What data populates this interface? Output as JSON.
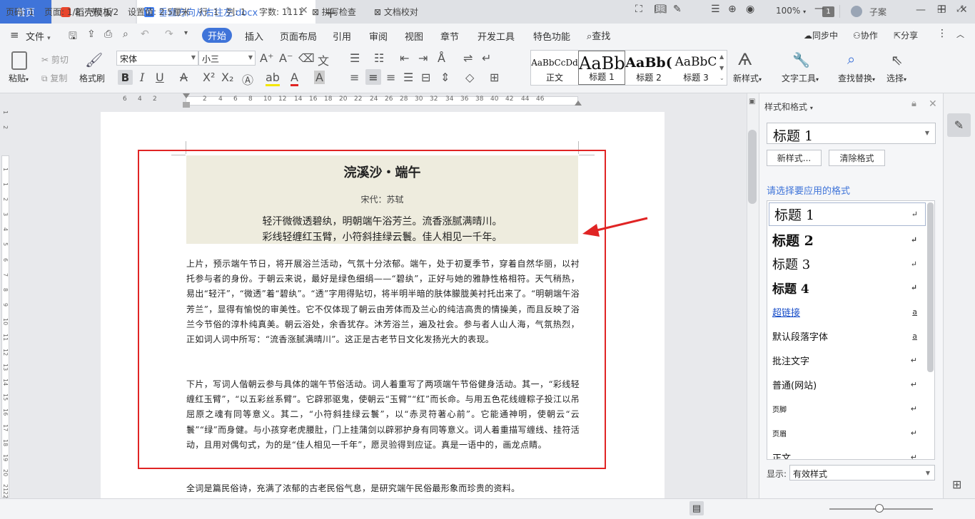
{
  "tabs": {
    "home": "首页",
    "templates": "稻壳模板",
    "document": "垂直方向从右往左.docx",
    "badge": "1",
    "user": "子案"
  },
  "menu": {
    "file": "文件",
    "items": [
      "开始",
      "插入",
      "页面布局",
      "引用",
      "审阅",
      "视图",
      "章节",
      "开发工具",
      "特色功能"
    ],
    "search": "查找",
    "sync": "同步中",
    "collab": "协作",
    "share": "分享"
  },
  "ribbon": {
    "paste": "粘贴",
    "cut": "剪切",
    "copy": "复制",
    "format_painter": "格式刷",
    "font_name": "宋体",
    "font_size": "小三",
    "styles": [
      {
        "preview": "AaBbCcDd",
        "name": "正文"
      },
      {
        "preview": "AaBb",
        "name": "标题 1"
      },
      {
        "preview": "AaBb(",
        "name": "标题 2"
      },
      {
        "preview": "AaBbC",
        "name": "标题 3"
      }
    ],
    "new_style": "新样式",
    "text_tools": "文字工具",
    "find_replace": "查找替换",
    "select": "选择"
  },
  "ruler": {
    "h_ticks": [
      "6",
      "4",
      "2",
      "2",
      "4",
      "6",
      "8",
      "10",
      "12",
      "14",
      "16",
      "18",
      "20",
      "22",
      "24",
      "26",
      "28",
      "30",
      "32",
      "34",
      "36",
      "38",
      "40",
      "42",
      "44",
      "46"
    ],
    "v_ticks": [
      "1",
      "2",
      "1",
      "1",
      "2",
      "3",
      "4",
      "5",
      "6",
      "7",
      "8",
      "9",
      "10",
      "11",
      "12",
      "13",
      "14",
      "15",
      "16",
      "17",
      "18",
      "19",
      "20",
      "21",
      "22",
      "23"
    ]
  },
  "document": {
    "title": "浣溪沙・端午",
    "author": "宋代：苏轼",
    "line1": "轻汗微微透碧纨，明朝端午浴芳兰。流香涨腻满晴川。",
    "line2": "彩线轻缠红玉臂，小符斜挂绿云鬟。佳人相见一千年。",
    "para1": "上片，预示端午节日，将开展浴兰活动，气氛十分浓郁。端午，处于初夏季节，穿着自然华丽，以衬托参与者的身份。于朝云来说，最好是绿色细绢——“碧纨”，正好与她的雅静性格相符。天气稍热，易出“轻汗”，“微透”着“碧纨”。“透”字用得贴切，将半明半暗的肤体朦胧美衬托出来了。“明朝端午浴芳兰”，显得有愉悦的审美性。它不仅体现了朝云由芳体而及兰心的纯洁高贵的情操美，而且反映了浴兰今节俗的淳朴纯真美。朝云浴处，余香犹存。沐芳浴兰，遍及社会。参与者人山人海，气氛热烈，正如词人词中所写：“流香涨腻满晴川”。这正是古老节日文化发扬光大的表现。",
    "para2": "下片，写词人偕朝云参与具体的端午节俗活动。词人着重写了两项端午节俗健身活动。其一，“彩线轻缠红玉臂”，“以五彩丝系臂”。它辟邪驱鬼，使朝云“玉臂”“红”而长命。与用五色花线缠粽子投江以吊屈原之魂有同等意义。其二，“小符斜挂绿云鬟”，以“赤灵符著心前”。它能通神明，使朝云“云鬟”“绿”而身健。与小孩穿老虎腰肚，门上挂蒲剑以辟邪护身有同等意义。词人着重描写缠线、挂符活动，且用对偶句式，为的是“佳人相见一千年”，愿灵验得到应证。真是一语中的，画龙点睛。",
    "para3": "全词是篇民俗诗，充满了浓郁的古老民俗气息，是研究端午民俗最形象而珍贵的资料。"
  },
  "panel": {
    "title": "样式和格式",
    "current_style": "标题  1",
    "new_style_btn": "新样式...",
    "clear_format_btn": "清除格式",
    "prompt": "请选择要应用的格式",
    "styles": [
      {
        "label": "标题  1",
        "mark": "↵"
      },
      {
        "label": "标题  2",
        "mark": "↵"
      },
      {
        "label": "标题  3",
        "mark": "↵"
      },
      {
        "label": "标题  4",
        "mark": "↵"
      },
      {
        "label": "超链接",
        "mark": "a"
      },
      {
        "label": "默认段落字体",
        "mark": "a"
      },
      {
        "label": "批注文字",
        "mark": "↵"
      },
      {
        "label": "普通(网站)",
        "mark": "↵"
      },
      {
        "label": "页脚",
        "mark": "↵"
      },
      {
        "label": "页眉",
        "mark": "↵"
      },
      {
        "label": "正文",
        "mark": "↵"
      }
    ],
    "show_label": "显示:",
    "show_value": "有效样式"
  },
  "status": {
    "page_no": "页码: 1",
    "page": "页面: 1/2",
    "section": "节: 1/2",
    "setting": "设置值: 2.5厘米",
    "row": "行: 1",
    "col": "列: 1",
    "chars": "字数: 1111",
    "spellcheck": "拼写检查",
    "proofread": "文档校对",
    "zoom": "100%"
  },
  "colors": {
    "accent": "#3f74d9",
    "highlight_box": "#e02424",
    "poem_bg": "#eeecde"
  }
}
